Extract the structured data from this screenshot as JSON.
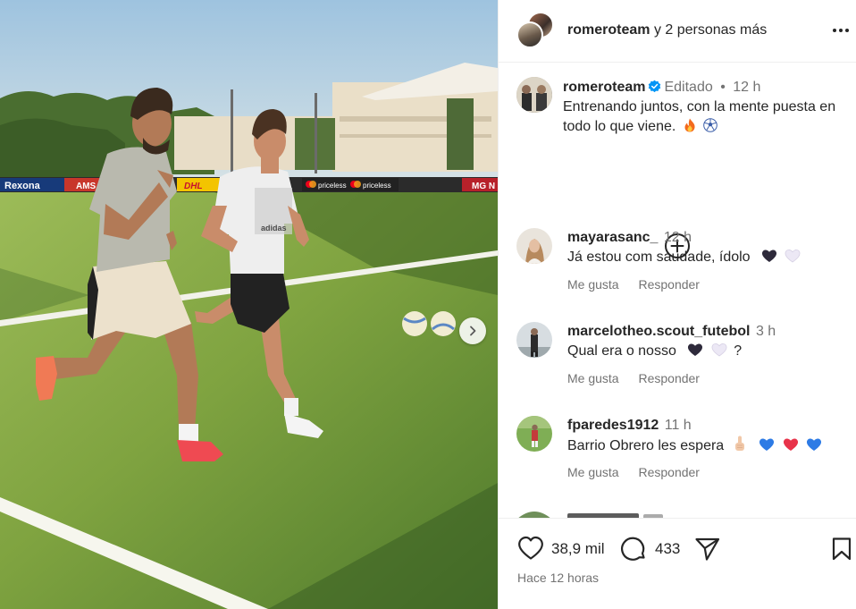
{
  "header": {
    "account": "romeroteam",
    "suffix": "y 2 personas más",
    "more_icon": "more-horizontal-icon"
  },
  "caption": {
    "username": "romeroteam",
    "verified_icon": "verified-badge-icon",
    "edited": "Editado",
    "dot": "•",
    "time": "12 h",
    "text": "Entrenando juntos, con la mente puesta en todo lo que viene.",
    "emojis": [
      "fire-emoji",
      "soccer-ball-emoji"
    ]
  },
  "load_more_icon": "add-circle-icon",
  "comments": [
    {
      "username": "mayarasanc_",
      "time": "12 h",
      "text": "Já estou com saudade, ídolo",
      "emojis": [
        "black-heart-emoji",
        "white-heart-emoji"
      ],
      "like_label": "Me gusta",
      "reply_label": "Responder"
    },
    {
      "username": "marcelotheo.scout_futebol",
      "time": "3 h",
      "text": "Qual era o nosso",
      "emojis": [
        "black-heart-emoji",
        "white-heart-emoji"
      ],
      "text_after": "?",
      "like_label": "Me gusta",
      "reply_label": "Responder"
    },
    {
      "username": "fparedes1912",
      "time": "11 h",
      "text": "Barrio Obrero les espera",
      "emojis": [
        "raised-index-finger-emoji",
        "blue-heart-emoji",
        "red-heart-emoji",
        "blue-heart-emoji"
      ],
      "like_label": "Me gusta",
      "reply_label": "Responder"
    }
  ],
  "action_bar": {
    "likes": "38,9 mil",
    "comments": "433",
    "timestamp": "Hace 12 horas",
    "icons": [
      "heart-outline-icon",
      "comment-bubble-icon",
      "share-paper-plane-icon",
      "bookmark-icon"
    ]
  },
  "photo": {
    "signage": [
      "Rexona",
      "AMS",
      "DHL",
      "priceless",
      "priceless",
      "MG N"
    ],
    "shirt_brand": "adidas",
    "next_icon": "chevron-right-icon"
  },
  "colors": {
    "text": "#262626",
    "muted": "#737373",
    "verified_blue": "#0095f6",
    "divider": "#efefef"
  }
}
